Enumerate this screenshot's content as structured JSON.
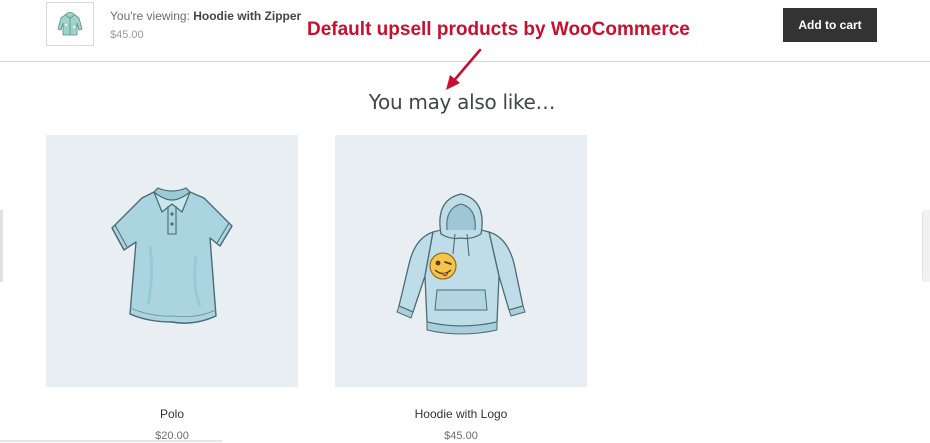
{
  "sticky_bar": {
    "viewing_prefix": "You're viewing: ",
    "product_name": "Hoodie with Zipper",
    "price": "$45.00",
    "add_to_cart_label": "Add to cart"
  },
  "annotation": {
    "text": "Default upsell products by WooCommerce",
    "color": "#c8102e"
  },
  "upsells": {
    "title": "You may also like…",
    "products": [
      {
        "name": "Polo",
        "price": "$20.00",
        "image_icon": "polo-shirt-image"
      },
      {
        "name": "Hoodie with Logo",
        "price": "$45.00",
        "image_icon": "hoodie-logo-image"
      }
    ]
  },
  "colors": {
    "button_bg": "#333333",
    "product_bg": "#e9eef2",
    "garment": "#a9d4e0"
  }
}
